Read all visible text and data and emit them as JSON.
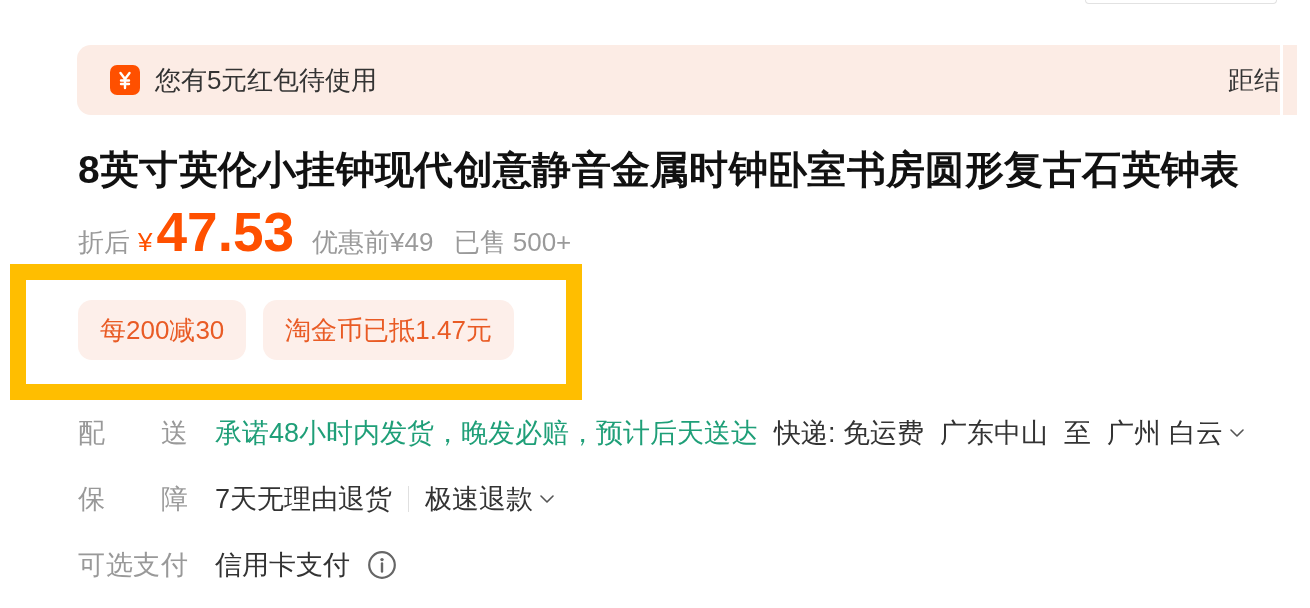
{
  "coupon_banner": {
    "message": "您有5元红包待使用",
    "countdown_label": "距结"
  },
  "product": {
    "title": "8英寸英伦小挂钟现代创意静音金属时钟卧室书房圆形复古石英钟表"
  },
  "price": {
    "label": "折后",
    "currency": "¥",
    "amount": "47.53",
    "original_price": "优惠前¥49",
    "sold": "已售 500+"
  },
  "promotions": [
    {
      "text": "每200减30"
    },
    {
      "text": "淘金币已抵1.47元"
    }
  ],
  "details": [
    {
      "label": "配送",
      "kind": "delivery",
      "segments": [
        {
          "text": "承诺48小时内发货，晚发必赔，预计后天送达",
          "highlight": true,
          "dropdown": false,
          "info": false
        },
        {
          "text": "快递: 免运费",
          "highlight": false,
          "dropdown": false,
          "info": false
        },
        {
          "text": "广东中山",
          "highlight": false,
          "dropdown": false,
          "info": false
        },
        {
          "text": "至",
          "highlight": false,
          "dropdown": false,
          "info": false
        },
        {
          "text": "广州 白云",
          "highlight": false,
          "dropdown": true,
          "info": false
        }
      ]
    },
    {
      "label": "保障",
      "kind": "guarantee",
      "segments": [
        {
          "text": "7天无理由退货",
          "highlight": false,
          "dropdown": false,
          "info": false
        },
        {
          "text": "极速退款",
          "highlight": false,
          "dropdown": true,
          "info": false
        }
      ]
    },
    {
      "label": "可选支付",
      "kind": "payment",
      "segments": [
        {
          "text": "信用卡支付",
          "highlight": false,
          "dropdown": false,
          "info": true
        }
      ]
    }
  ]
}
